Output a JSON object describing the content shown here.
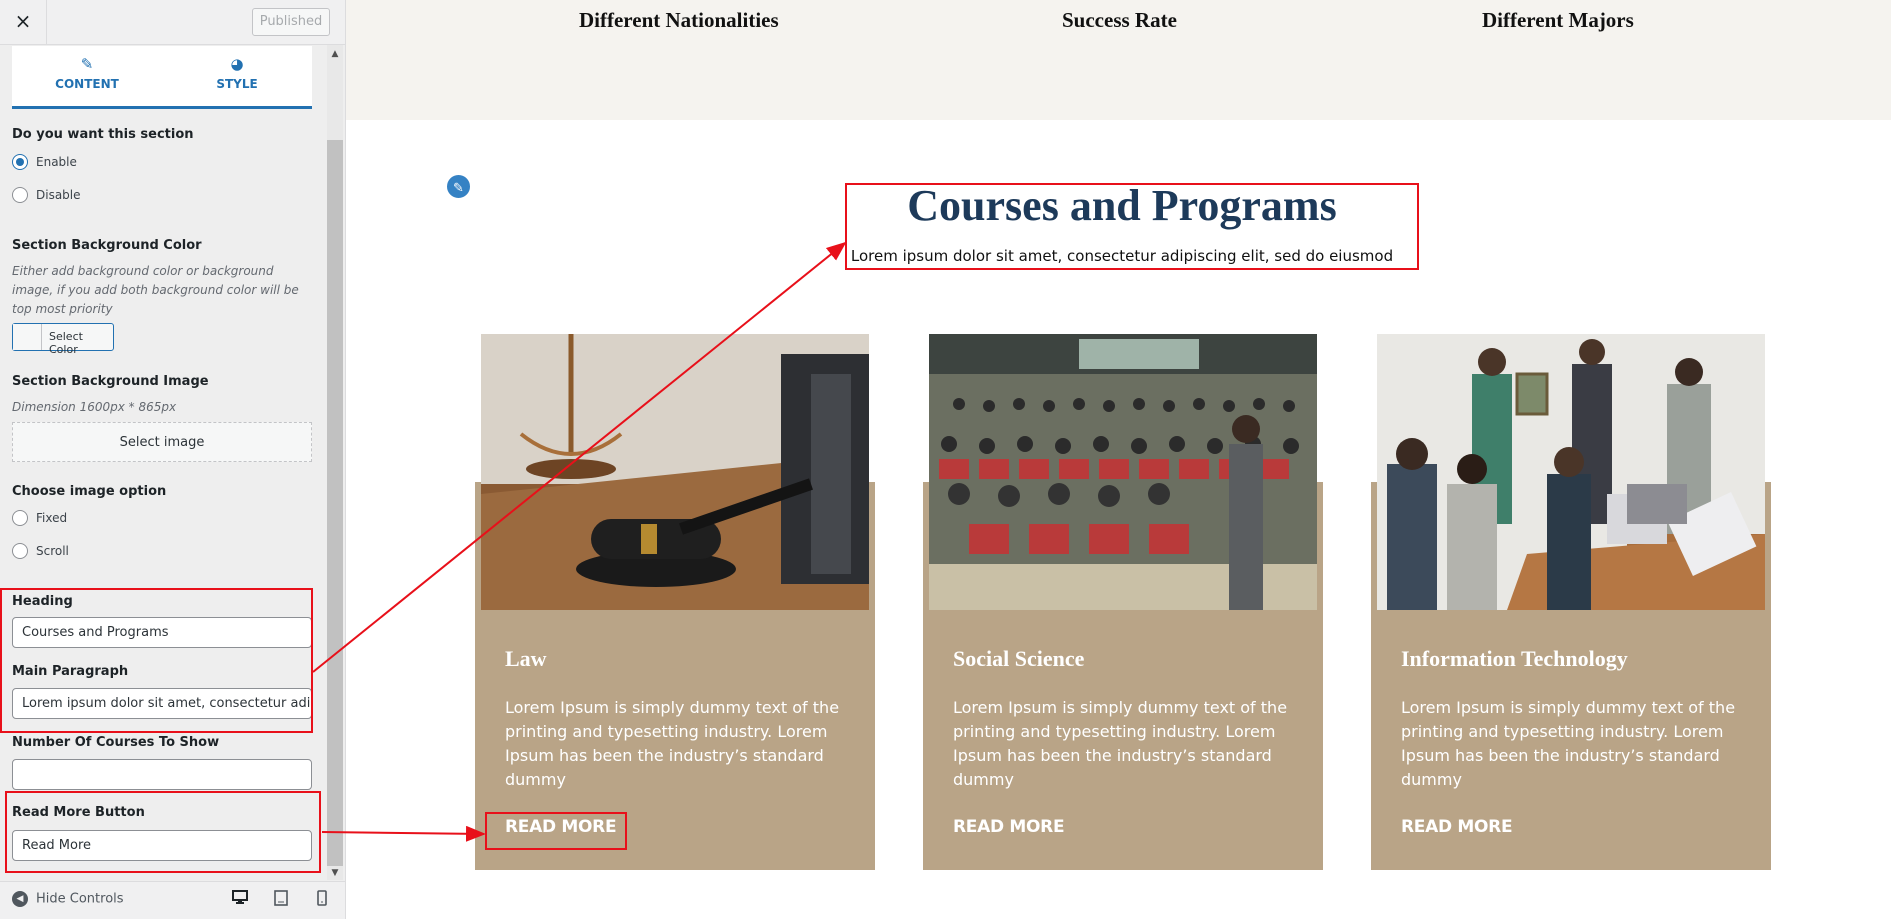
{
  "panel": {
    "close_icon": "×",
    "publish_status": "Published",
    "tabs": [
      {
        "label": "CONTENT",
        "icon": "edit-icon"
      },
      {
        "label": "STYLE",
        "icon": "palette-icon"
      }
    ],
    "section_toggle": {
      "label": "Do you want this section",
      "options": [
        "Enable",
        "Disable"
      ],
      "selected": "Enable"
    },
    "bg_color": {
      "label": "Section Background Color",
      "help": "Either add background color or background image, if you add both background color will be top most priority",
      "button": "Select Color"
    },
    "bg_image": {
      "label": "Section Background Image",
      "help": "Dimension 1600px * 865px",
      "button": "Select image"
    },
    "image_option": {
      "label": "Choose image option",
      "options": [
        "Fixed",
        "Scroll"
      ]
    },
    "heading": {
      "label": "Heading",
      "value": "Courses and Programs"
    },
    "main_paragraph": {
      "label": "Main Paragraph",
      "value": "Lorem ipsum dolor sit amet, consectetur adipiscing elit, sed do eiusmod"
    },
    "courses_count": {
      "label": "Number Of Courses To Show",
      "value": ""
    },
    "read_more": {
      "label": "Read More Button",
      "value": "Read More"
    },
    "footer": {
      "hide_controls": "Hide Controls",
      "devices": [
        "desktop-icon",
        "tablet-icon",
        "mobile-icon"
      ]
    }
  },
  "preview": {
    "stats": [
      "Different Nationalities",
      "Success Rate",
      "Different Majors"
    ],
    "section": {
      "title": "Courses and Programs",
      "paragraph": "Lorem ipsum dolor sit amet, consectetur adipiscing elit, sed do eiusmod"
    },
    "courses": [
      {
        "title": "Law",
        "text": "Lorem Ipsum is simply dummy text of the printing and typesetting industry. Lorem Ipsum has been the industry’s standard dummy",
        "button": "READ MORE"
      },
      {
        "title": "Social Science",
        "text": "Lorem Ipsum is simply dummy text of the printing and typesetting industry. Lorem Ipsum has been the industry’s standard dummy",
        "button": "READ MORE"
      },
      {
        "title": "Information Technology",
        "text": "Lorem Ipsum is simply dummy text of the printing and typesetting industry. Lorem Ipsum has been the industry’s standard dummy",
        "button": "READ MORE"
      }
    ]
  },
  "colors": {
    "accent": "#2271b1",
    "card": "#b9a487",
    "heading": "#1d3a5a",
    "annotation": "#e8101a"
  }
}
